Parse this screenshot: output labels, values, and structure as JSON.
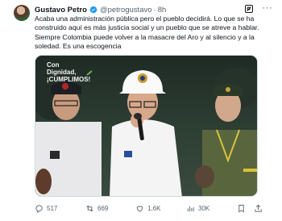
{
  "author": {
    "name": "Gustavo Petro",
    "handle": "@petrogustavo",
    "time": "8h",
    "verified_color": "#1d9bf0"
  },
  "tweet_text": "Acaba una administración pública pero el pueblo decidirá. Lo que se ha construido aquí es más justicia social y un pueblo que se atreve a hablar. Siempre Colombia puede volver a la masacre del Aro y al silencio y a la soledad. Es una escogencia",
  "media": {
    "overlay_line1": "Con",
    "overlay_line2": "Dignidad,",
    "overlay_line3": "¡CUMPLIMOS!"
  },
  "actions": {
    "replies": "517",
    "reposts": "669",
    "likes": "1,6K",
    "views": "30K"
  },
  "icons": [
    "verified-badge-icon",
    "grok-icon",
    "more-icon",
    "reply-icon",
    "repost-icon",
    "like-icon",
    "views-icon",
    "bookmark-icon",
    "share-icon"
  ]
}
